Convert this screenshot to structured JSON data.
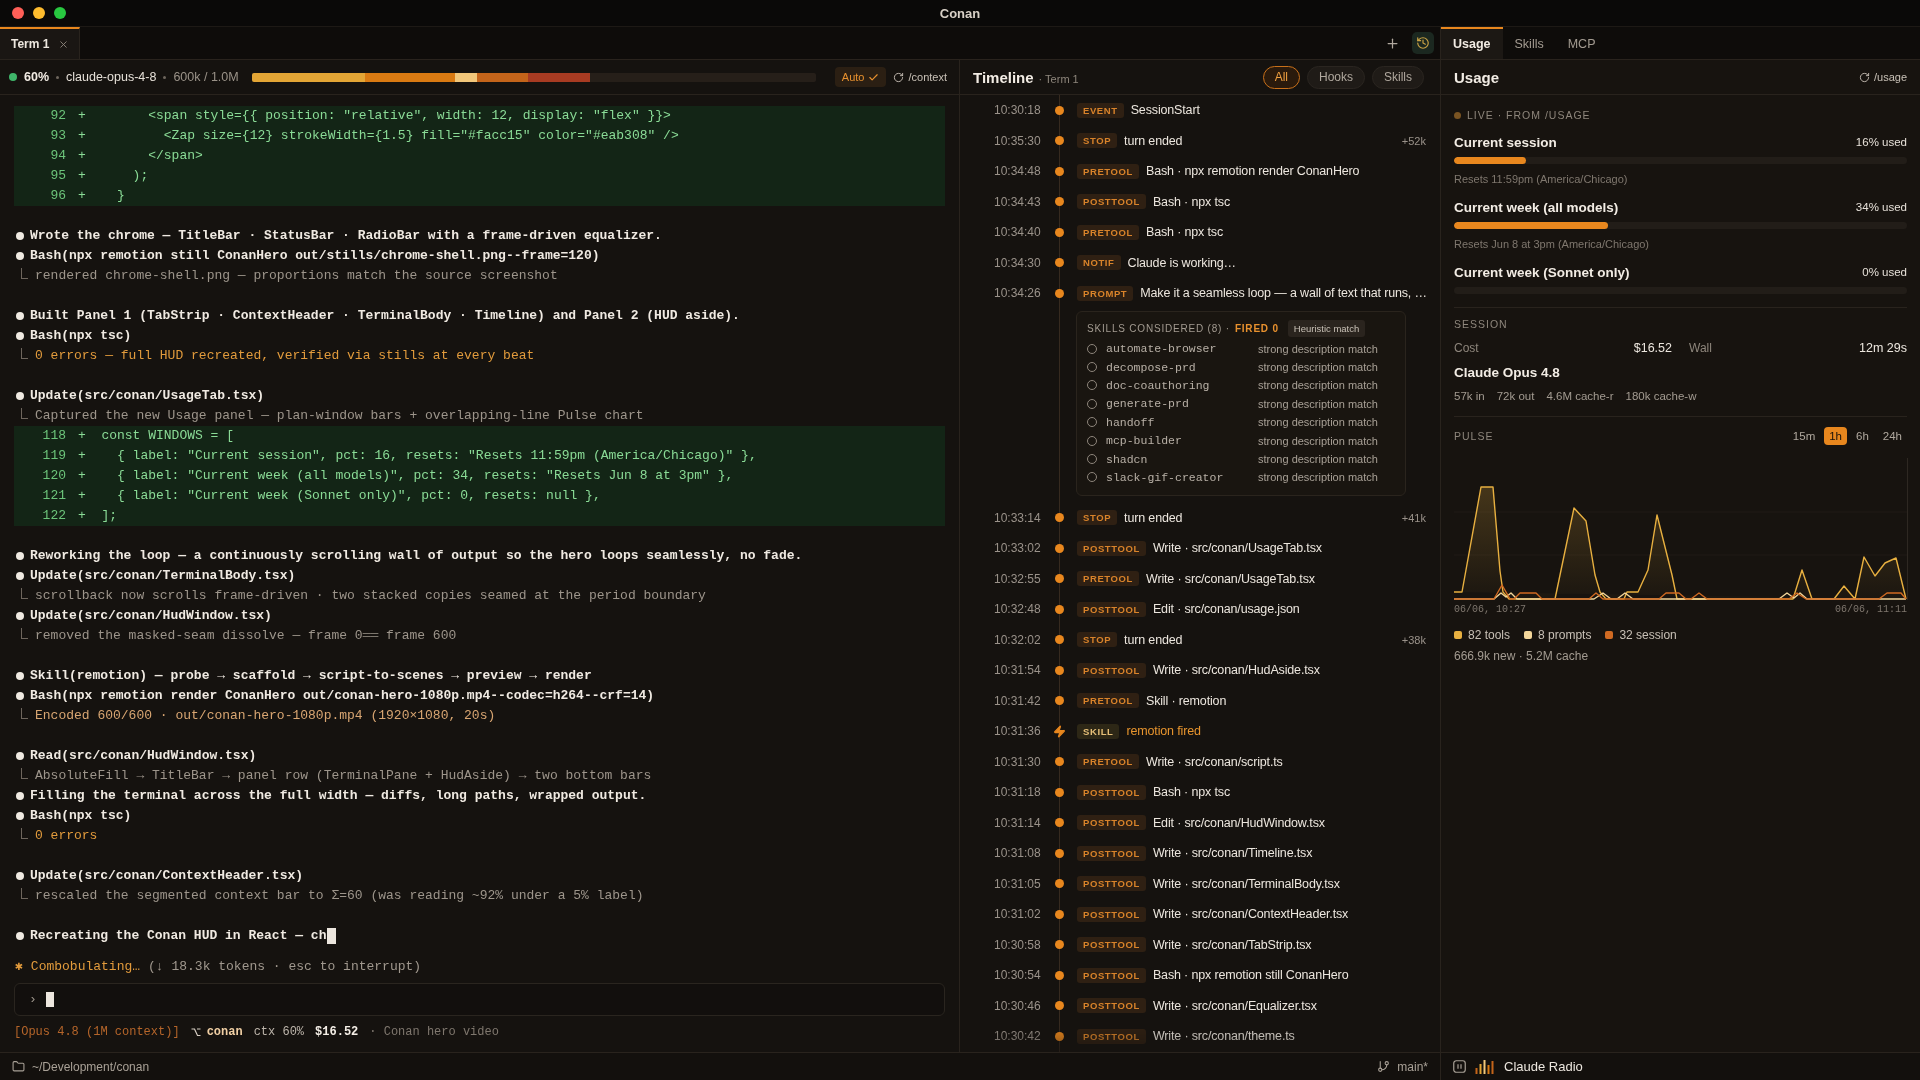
{
  "window": {
    "title": "Conan"
  },
  "tabs": [
    {
      "label": "Term 1",
      "selected": true
    }
  ],
  "terminal": {
    "context": {
      "percent": "60%",
      "model": "claude-opus-4-8",
      "tokens": "600k / 1.0M",
      "level": 0.6,
      "mode": "Auto",
      "command": "/context"
    },
    "groups": [
      {
        "entries": [
          {
            "kind": "diff",
            "lines": [
              {
                "number": "92",
                "code": "+        <span style={{ position: \"relative\", width: 12, display: \"flex\" }}>"
              },
              {
                "number": "93",
                "code": "+          <Zap size={12} strokeWidth={1.5} fill=\"#facc15\" color=\"#eab308\" />"
              },
              {
                "number": "94",
                "code": "+        </span>"
              },
              {
                "number": "95",
                "code": "+      );"
              },
              {
                "number": "96",
                "code": "+    }"
              }
            ]
          }
        ]
      },
      {
        "entries": [
          {
            "kind": "action",
            "text": "Wrote the chrome — TitleBar · StatusBar · RadioBar with a frame-driven equalizer."
          },
          {
            "kind": "action",
            "text": "Bash(npx remotion still ConanHero out/stills/chrome-shell.png--frame=120)"
          },
          {
            "kind": "note",
            "text": "rendered chrome-shell.png — proportions match the source screenshot"
          }
        ]
      },
      {
        "entries": [
          {
            "kind": "action",
            "text": "Built Panel 1 (TabStrip · ContextHeader · TerminalBody · Timeline) and Panel 2 (HUD aside)."
          },
          {
            "kind": "action",
            "text": "Bash(npx tsc)"
          },
          {
            "kind": "success",
            "text": "0 errors — full HUD recreated, verified via stills at every beat"
          }
        ]
      },
      {
        "entries": [
          {
            "kind": "action",
            "text": "Update(src/conan/UsageTab.tsx)"
          },
          {
            "kind": "note",
            "text": "Captured the new Usage panel — plan-window bars + overlapping-line Pulse chart"
          },
          {
            "kind": "diff",
            "lines": [
              {
                "number": "118",
                "code": "+  const WINDOWS = ["
              },
              {
                "number": "119",
                "code": "+    { label: \"Current session\", pct: 16, resets: \"Resets 11:59pm (America/Chicago)\" },"
              },
              {
                "number": "120",
                "code": "+    { label: \"Current week (all models)\", pct: 34, resets: \"Resets Jun 8 at 3pm\" },"
              },
              {
                "number": "121",
                "code": "+    { label: \"Current week (Sonnet only)\", pct: 0, resets: null },"
              },
              {
                "number": "122",
                "code": "+  ];"
              }
            ]
          }
        ]
      },
      {
        "entries": [
          {
            "kind": "action",
            "text": "Reworking the loop — a continuously scrolling wall of output so the hero loops seamlessly, no fade."
          },
          {
            "kind": "action",
            "text": "Update(src/conan/TerminalBody.tsx)"
          },
          {
            "kind": "note",
            "text": "scrollback now scrolls frame-driven · two stacked copies seamed at the period boundary"
          },
          {
            "kind": "action",
            "text": "Update(src/conan/HudWindow.tsx)"
          },
          {
            "kind": "note",
            "text": "removed the masked-seam dissolve — frame 0══ frame 600"
          }
        ]
      },
      {
        "entries": [
          {
            "kind": "action",
            "text": "Skill(remotion) — probe → scaffold → script-to-scenes → preview → render"
          },
          {
            "kind": "action",
            "text": "Bash(npx remotion render ConanHero out/conan-hero-1080p.mp4--codec=h264--crf=14)"
          },
          {
            "kind": "output",
            "text": "Encoded 600/600 · out/conan-hero-1080p.mp4 (1920×1080, 20s)"
          }
        ]
      },
      {
        "entries": [
          {
            "kind": "action",
            "text": "Read(src/conan/HudWindow.tsx)"
          },
          {
            "kind": "note",
            "text": "AbsoluteFill → TitleBar → panel row (TerminalPane + HudAside) → two bottom bars"
          },
          {
            "kind": "action",
            "text": "Filling the terminal across the full width — diffs, long paths, wrapped output."
          },
          {
            "kind": "action",
            "text": "Bash(npx tsc)"
          },
          {
            "kind": "success",
            "text": "0 errors"
          }
        ]
      },
      {
        "entries": [
          {
            "kind": "action",
            "text": "Update(src/conan/ContextHeader.tsx)"
          },
          {
            "kind": "note",
            "text": "rescaled the segmented context bar to Σ=60 (was reading ~92% under a 5% label)"
          }
        ]
      },
      {
        "entries": [
          {
            "kind": "streaming",
            "text": "Recreating the Conan HUD in React — ch"
          }
        ]
      }
    ],
    "activity": {
      "spinner": "✱",
      "verb": "Combobulating…",
      "detail": "(↓ 18.3k tokens · esc to interrupt)"
    },
    "input": {
      "prompt": "›"
    },
    "statusline": {
      "model": "[Opus 4.8 (1M context)]",
      "branch": "conan",
      "context": "ctx 60%",
      "cost": "$16.52",
      "title": "· Conan hero video"
    }
  },
  "timeline": {
    "title": "Timeline",
    "subtitle": "· Term 1",
    "filters": [
      {
        "label": "All",
        "selected": true
      },
      {
        "label": "Hooks",
        "selected": false
      },
      {
        "label": "Skills",
        "selected": false
      }
    ],
    "events": [
      {
        "time": "10:30:18",
        "kind": "hook",
        "badge": "EVENT",
        "text": "SessionStart"
      },
      {
        "time": "10:35:30",
        "kind": "hook",
        "badge": "STOP",
        "text": "turn ended",
        "delta": "+52k"
      },
      {
        "time": "10:34:48",
        "kind": "hook",
        "badge": "PRETOOL",
        "text": "Bash · npx remotion render ConanHero"
      },
      {
        "time": "10:34:43",
        "kind": "hook",
        "badge": "POSTTOOL",
        "text": "Bash · npx tsc"
      },
      {
        "time": "10:34:40",
        "kind": "hook",
        "badge": "PRETOOL",
        "text": "Bash · npx tsc"
      },
      {
        "time": "10:34:30",
        "kind": "hook",
        "badge": "NOTIF",
        "text": "Claude is working…"
      },
      {
        "time": "10:34:26",
        "kind": "hook",
        "badge": "PROMPT",
        "text": "Make it a seamless loop — a wall of text that runs, …",
        "skills": {
          "title": "SKILLS CONSIDERED (8) ·",
          "fired": "FIRED 0",
          "tag": "Heuristic match",
          "items": [
            {
              "name": "automate-browser",
              "reason": "strong description match",
              "fired": false
            },
            {
              "name": "decompose-prd",
              "reason": "strong description match",
              "fired": false
            },
            {
              "name": "doc-coauthoring",
              "reason": "strong description match",
              "fired": false
            },
            {
              "name": "generate-prd",
              "reason": "strong description match",
              "fired": false
            },
            {
              "name": "handoff",
              "reason": "strong description match",
              "fired": false
            },
            {
              "name": "mcp-builder",
              "reason": "strong description match",
              "fired": false
            },
            {
              "name": "shadcn",
              "reason": "strong description match",
              "fired": false
            },
            {
              "name": "slack-gif-creator",
              "reason": "strong description match",
              "fired": false
            }
          ]
        }
      },
      {
        "time": "10:33:14",
        "kind": "hook",
        "badge": "STOP",
        "text": "turn ended",
        "delta": "+41k"
      },
      {
        "time": "10:33:02",
        "kind": "hook",
        "badge": "POSTTOOL",
        "text": "Write · src/conan/UsageTab.tsx"
      },
      {
        "time": "10:32:55",
        "kind": "hook",
        "badge": "PRETOOL",
        "text": "Write · src/conan/UsageTab.tsx"
      },
      {
        "time": "10:32:48",
        "kind": "hook",
        "badge": "POSTTOOL",
        "text": "Edit · src/conan/usage.json"
      },
      {
        "time": "10:32:02",
        "kind": "hook",
        "badge": "STOP",
        "text": "turn ended",
        "delta": "+38k"
      },
      {
        "time": "10:31:54",
        "kind": "hook",
        "badge": "POSTTOOL",
        "text": "Write · src/conan/HudAside.tsx"
      },
      {
        "time": "10:31:42",
        "kind": "hook",
        "badge": "PRETOOL",
        "text": "Skill · remotion"
      },
      {
        "time": "10:31:36",
        "kind": "skill",
        "badge": "SKILL",
        "text": "remotion fired"
      },
      {
        "time": "10:31:30",
        "kind": "hook",
        "badge": "PRETOOL",
        "text": "Write · src/conan/script.ts"
      },
      {
        "time": "10:31:18",
        "kind": "hook",
        "badge": "POSTTOOL",
        "text": "Bash · npx tsc"
      },
      {
        "time": "10:31:14",
        "kind": "hook",
        "badge": "POSTTOOL",
        "text": "Edit · src/conan/HudWindow.tsx"
      },
      {
        "time": "10:31:08",
        "kind": "hook",
        "badge": "POSTTOOL",
        "text": "Write · src/conan/Timeline.tsx"
      },
      {
        "time": "10:31:05",
        "kind": "hook",
        "badge": "POSTTOOL",
        "text": "Write · src/conan/TerminalBody.tsx"
      },
      {
        "time": "10:31:02",
        "kind": "hook",
        "badge": "POSTTOOL",
        "text": "Write · src/conan/ContextHeader.tsx"
      },
      {
        "time": "10:30:58",
        "kind": "hook",
        "badge": "POSTTOOL",
        "text": "Write · src/conan/TabStrip.tsx"
      },
      {
        "time": "10:30:54",
        "kind": "hook",
        "badge": "POSTTOOL",
        "text": "Bash · npx remotion still ConanHero"
      },
      {
        "time": "10:30:46",
        "kind": "hook",
        "badge": "POSTTOOL",
        "text": "Write · src/conan/Equalizer.tsx"
      },
      {
        "time": "10:30:42",
        "kind": "hook",
        "badge": "POSTTOOL",
        "text": "Write · src/conan/theme.ts"
      }
    ]
  },
  "aside": {
    "tabs": [
      {
        "label": "Usage",
        "selected": true
      },
      {
        "label": "Skills",
        "selected": false
      },
      {
        "label": "MCP",
        "selected": false
      }
    ],
    "title": "Usage",
    "command": "/usage",
    "live": "LIVE · FROM /USAGE",
    "limits": [
      {
        "label": "Current session",
        "used": "16% used",
        "level": 0.16,
        "resets": "Resets 11:59pm (America/Chicago)"
      },
      {
        "label": "Current week (all models)",
        "used": "34% used",
        "level": 0.34,
        "resets": "Resets Jun 8 at 3pm (America/Chicago)"
      },
      {
        "label": "Current week (Sonnet only)",
        "used": "0% used"
      }
    ],
    "session": {
      "heading": "SESSION",
      "stats": [
        {
          "label": "Cost",
          "value": "$16.52"
        },
        {
          "label": "Wall",
          "value": "12m 29s"
        }
      ],
      "model": "Claude Opus 4.8",
      "tokens": [
        "57k in",
        "72k out",
        "4.6M cache-r",
        "180k cache-w"
      ]
    },
    "pulse": {
      "heading": "PULSE",
      "ranges": [
        {
          "label": "15m",
          "selected": false
        },
        {
          "label": "1h",
          "selected": true
        },
        {
          "label": "6h",
          "selected": false
        },
        {
          "label": "24h",
          "selected": false
        }
      ],
      "axis": [
        "06/06, 10:27",
        "06/06, 11:11"
      ],
      "legend": [
        {
          "label": "82 tools",
          "color": "#e8b040"
        },
        {
          "label": "8 prompts",
          "color": "#f3d69a"
        },
        {
          "label": "32 session",
          "color": "#d06a22"
        }
      ],
      "summary": "666.9k new · 5.2M cache"
    }
  },
  "status_bar": {
    "path": "~/Development/conan",
    "branch": "main*",
    "radio": "Claude Radio"
  }
}
